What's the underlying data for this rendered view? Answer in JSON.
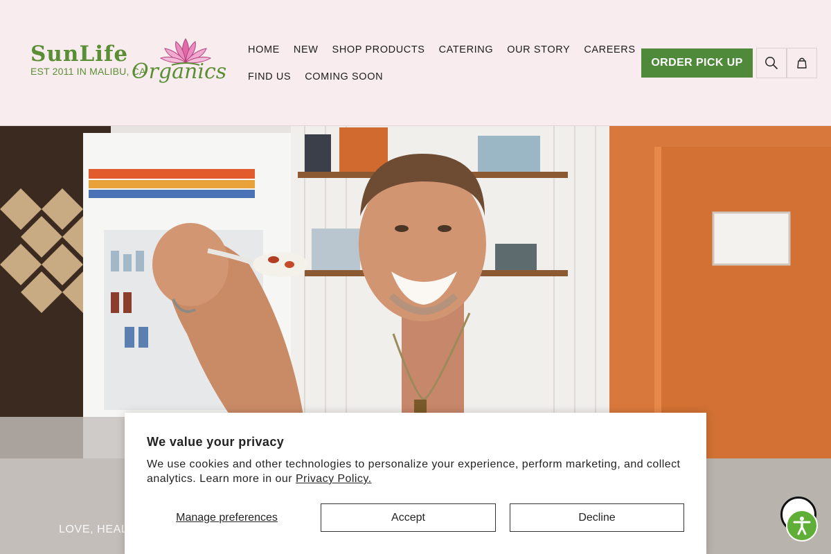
{
  "brand": {
    "wordmark_a": "SunLife",
    "est": "EST 2011 IN MALIBU, CA",
    "organics": "Organics"
  },
  "nav": {
    "items": [
      "HOME",
      "NEW",
      "SHOP PRODUCTS",
      "CATERING",
      "OUR STORY",
      "CAREERS",
      "FIND US",
      "COMING SOON"
    ]
  },
  "header_actions": {
    "order_label": "ORDER PICK UP",
    "search_icon": "search-icon",
    "cart_icon": "cart-icon"
  },
  "hero": {
    "tagline": "LOVE, HEAL"
  },
  "cookie_banner": {
    "title": "We value your privacy",
    "text": "We use cookies and other technologies to personalize your experience, perform marketing, and collect analytics. Learn more in our",
    "policy_link": "Privacy Policy.",
    "manage_label": "Manage preferences",
    "accept_label": "Accept",
    "decline_label": "Decline"
  },
  "accessibility": {
    "icon": "accessibility-icon"
  },
  "colors": {
    "header_bg": "#f9ecee",
    "brand_green": "#5a8e34",
    "button_green": "#4e8a3a",
    "widget_green": "#5fae37",
    "wall_orange": "#d9783c"
  }
}
